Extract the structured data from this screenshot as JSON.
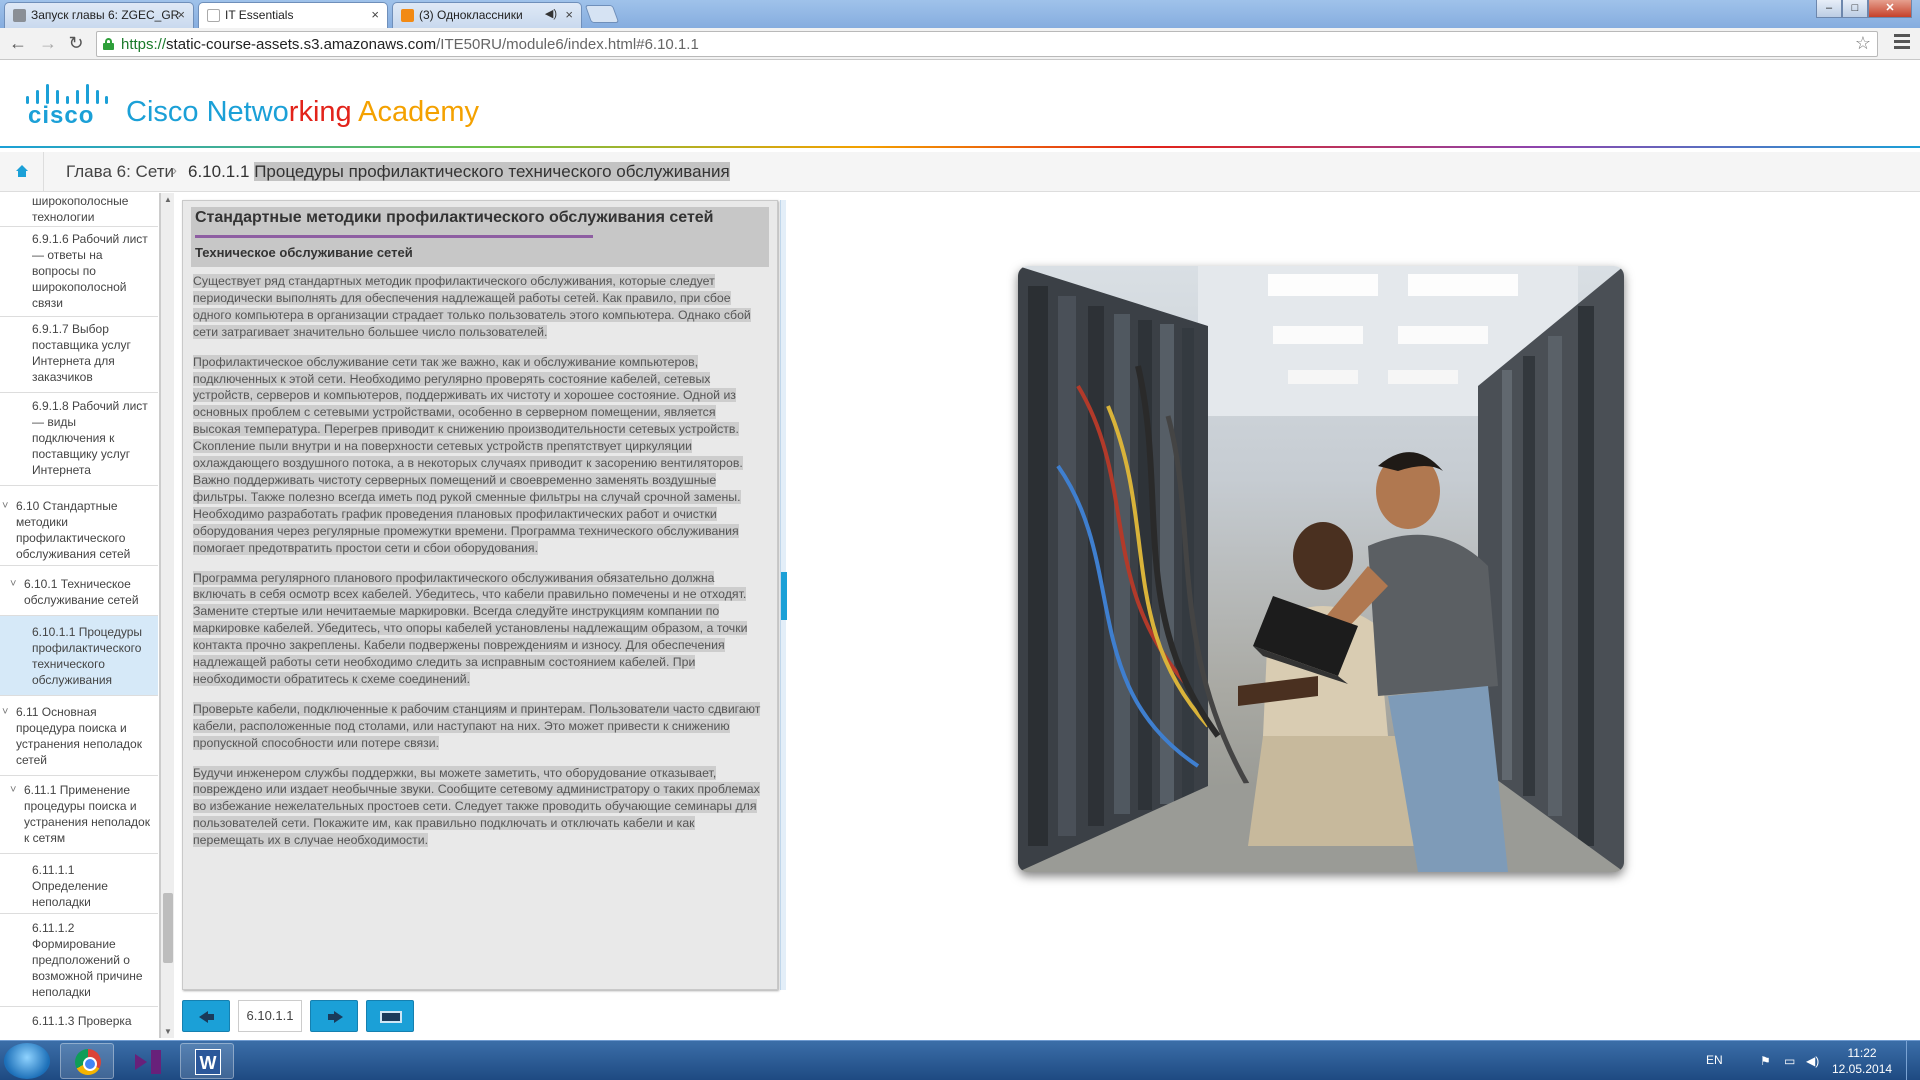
{
  "browser": {
    "tabs": [
      {
        "label": "Запуск главы 6: ZGEC_GR",
        "active": false
      },
      {
        "label": "IT Essentials",
        "active": true
      },
      {
        "label": "(3) Одноклассники",
        "active": false
      }
    ],
    "close_glyph": "×",
    "url_protocol": "https://",
    "url_host": "static-course-assets.s3.amazonaws.com",
    "url_path": "/ITE50RU/module6/index.html#6.10.1.1",
    "icons": [
      "back-icon",
      "forward-icon",
      "reload-icon",
      "lock-icon",
      "star-icon",
      "menu-icon"
    ]
  },
  "window_controls": {
    "minimize": "–",
    "maximize": "□",
    "close": "✕"
  },
  "brand": {
    "logo_word": "cisco",
    "title_parts": [
      {
        "text": "Cisco ",
        "color": "#1ba0d7"
      },
      {
        "text": "Netwo",
        "color": "#1ba0d7"
      },
      {
        "text": "rking ",
        "color": "#e2231a"
      },
      {
        "text": "Academy",
        "color": "#f4a100"
      }
    ]
  },
  "breadcrumb": {
    "chapter": "Глава 6: Сети",
    "separator": "›",
    "page_number": "6.10.1.1",
    "page_title": "Процедуры профилактического технического обслуживания"
  },
  "sidebar": {
    "items": [
      {
        "label": "широкополосные технологии",
        "level": 3
      },
      {
        "label": "6.9.1.6 Рабочий лист — ответы на вопросы по широкополосной связи",
        "level": 3
      },
      {
        "label": "6.9.1.7 Выбор поставщика услуг Интернета для заказчиков",
        "level": 3
      },
      {
        "label": "6.9.1.8 Рабочий лист — виды подключения к поставщику услуг Интернета",
        "level": 3
      },
      {
        "label": "6.10 Стандартные методики профилактического обслуживания сетей",
        "level": 1
      },
      {
        "label": "6.10.1 Техническое обслуживание сетей",
        "level": 2
      },
      {
        "label": "6.10.1.1 Процедуры профилактического технического обслуживания",
        "level": 3
      },
      {
        "label": "6.11 Основная процедура поиска и устранения неполадок сетей",
        "level": 1
      },
      {
        "label": "6.11.1 Применение процедуры поиска и устранения неполадок к сетям",
        "level": 2
      },
      {
        "label": "6.11.1.1 Определение неполадки",
        "level": 3
      },
      {
        "label": "6.11.1.2 Формирование предположений о возможной причине неполадки",
        "level": 3
      },
      {
        "label": "6.11.1.3 Проверка",
        "level": 3
      }
    ],
    "twisty": "˅",
    "scroll_up": "▲",
    "scroll_down": "▼"
  },
  "content": {
    "title": "Стандартные методики профилактического обслуживания сетей",
    "subtitle": "Техническое обслуживание сетей",
    "paragraphs": [
      "Существует ряд стандартных методик профилактического обслуживания, которые следует периодически выполнять для обеспечения надлежащей работы сетей. Как правило, при сбое одного компьютера в организации страдает только пользователь этого компьютера. Однако сбой сети затрагивает значительно большее число пользователей.",
      "Профилактическое обслуживание сети так же важно, как и обслуживание компьютеров, подключенных к этой сети. Необходимо регулярно проверять состояние кабелей, сетевых устройств, серверов и компьютеров, поддерживать их чистоту и хорошее состояние. Одной из основных проблем с сетевыми устройствами, особенно в серверном помещении, является высокая температура. Перегрев приводит к снижению производительности сетевых устройств. Скопление пыли внутри и на поверхности сетевых устройств препятствует циркуляции охлаждающего воздушного потока, а в некоторых случаях приводит к засорению вентиляторов. Важно поддерживать чистоту серверных помещений и своевременно заменять воздушные фильтры. Также полезно всегда иметь под рукой сменные фильтры на случай срочной замены. Необходимо разработать график проведения плановых профилактических работ и очистки оборудования через регулярные промежутки времени. Программа технического обслуживания помогает предотвратить простои сети и сбои оборудования.",
      "Программа регулярного планового профилактического обслуживания обязательно должна включать в себя осмотр всех кабелей. Убедитесь, что кабели правильно помечены и не отходят. Замените стертые или нечитаемые маркировки. Всегда следуйте инструкциям компании по маркировке кабелей. Убедитесь, что опоры кабелей установлены надлежащим образом, а точки контакта прочно закреплены. Кабели подвержены повреждениям и износу. Для обеспечения надлежащей работы сети необходимо следить за исправным состоянием кабелей. При необходимости обратитесь к схеме соединений.",
      "Проверьте кабели, подключенные к рабочим станциям и принтерам. Пользователи часто сдвигают кабели, расположенные под столами, или наступают на них. Это может привести к снижению пропускной способности или потере связи.",
      "Будучи инженером службы поддержки, вы можете заметить, что оборудование отказывает, повреждено или издает необычные звуки. Сообщите сетевому администратору о таких проблемах во избежание нежелательных простоев сети. Следует также проводить обучающие семинары для пользователей сети. Покажите им, как правильно подключать и отключать кабели и как перемещать их в случае необходимости."
    ]
  },
  "navigation": {
    "page_number": "6.10.1.1",
    "prev_icon": "arrow-left-icon",
    "next_icon": "arrow-right-icon",
    "toc_icon": "screen-icon"
  },
  "taskbar": {
    "language": "EN",
    "time": "11:22",
    "date": "12.05.2014",
    "word_letter": "W",
    "tray_icons": {
      "flag": "⚑",
      "network": "▭",
      "volume": "◀)"
    }
  },
  "colors": {
    "accent": "#1ba0d7",
    "title_underline": "#8e5ea2",
    "text_highlight": "#cdcdcd"
  }
}
